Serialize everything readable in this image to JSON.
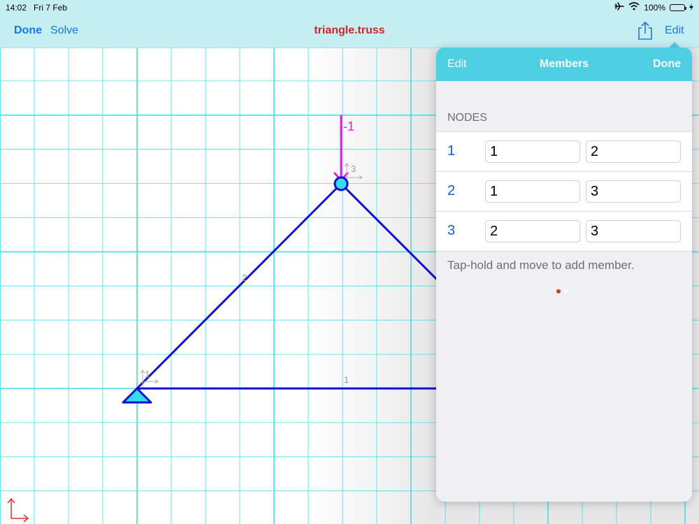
{
  "status_bar": {
    "time": "14:02",
    "date": "Fri 7 Feb",
    "battery": "100%",
    "icons": [
      "airplane-icon",
      "wifi-icon",
      "battery-icon",
      "charging-icon"
    ]
  },
  "nav": {
    "done_label": "Done",
    "solve_label": "Solve",
    "title": "triangle.truss",
    "share_icon": "share-icon",
    "edit_label": "Edit"
  },
  "canvas": {
    "load_label": "-1",
    "member_labels": [
      "1",
      "2"
    ],
    "node_labels": [
      "1",
      "3"
    ],
    "axis_icon": "axes-icon"
  },
  "popover": {
    "edit_label": "Edit",
    "title": "Members",
    "done_label": "Done",
    "section_header": "NODES",
    "rows": [
      {
        "index": "1",
        "node_a": "1",
        "node_b": "2"
      },
      {
        "index": "2",
        "node_a": "1",
        "node_b": "3"
      },
      {
        "index": "3",
        "node_a": "2",
        "node_b": "3"
      }
    ],
    "hint": "Tap-hold and move to add member.",
    "page_dots": {
      "count": 2,
      "active": 0
    }
  },
  "colors": {
    "accent": "#1a78d8",
    "title": "#c62a2a",
    "header": "#4fcfe3",
    "grid": "#40e0e8",
    "member": "#1010d0",
    "load": "#e020e0",
    "node_fill": "#33ddee"
  }
}
